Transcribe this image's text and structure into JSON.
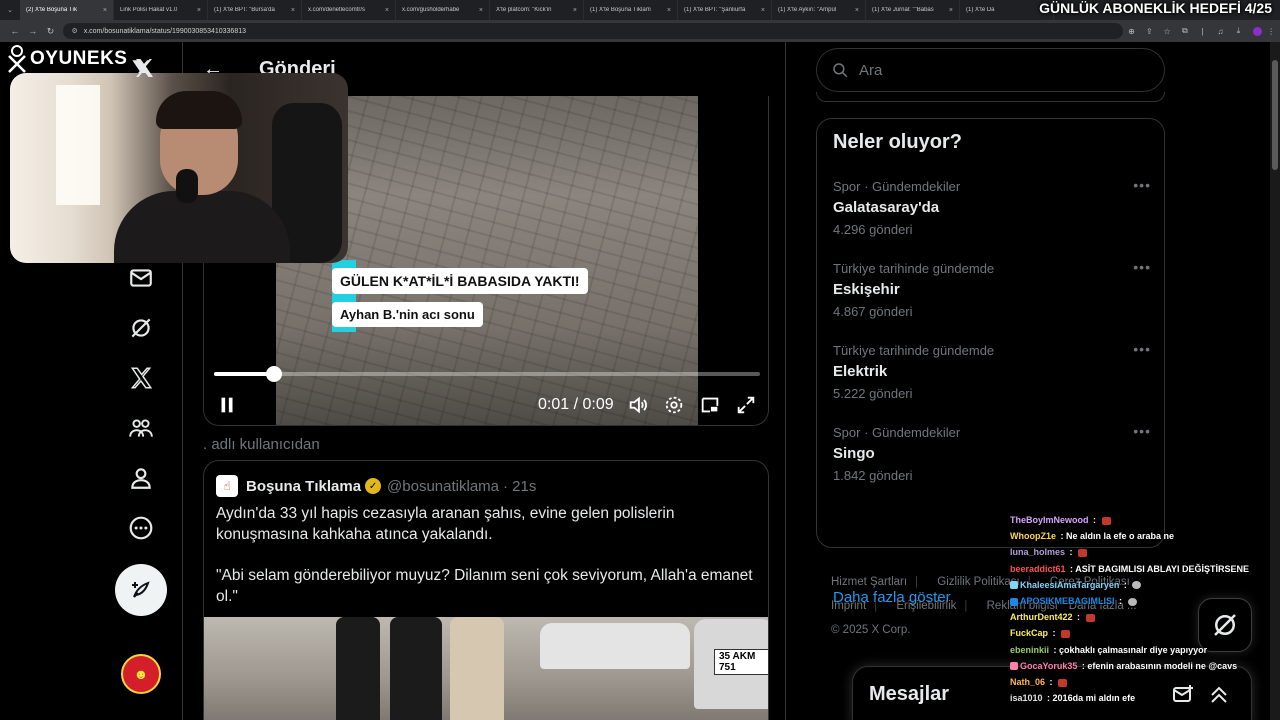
{
  "browser": {
    "tabs": [
      {
        "label": "(2) X'te Boşuna Tık",
        "active": true
      },
      {
        "label": "Link Polisi Hakat v1.0",
        "active": false
      },
      {
        "label": "(1) X'te BPT: \"Bursa'da",
        "active": false
      },
      {
        "label": "x.com/denetlecomtr/s",
        "active": false
      },
      {
        "label": "x.com/gusholderhabe",
        "active": false
      },
      {
        "label": "X'te platcom: \"Kick'in",
        "active": false
      },
      {
        "label": "(1) X'te Boşuna Tıklam",
        "active": false
      },
      {
        "label": "(1) X'te BPT: \"Şanlıurfa",
        "active": false
      },
      {
        "label": "(1) X'te Aykırı: \"Ampül",
        "active": false
      },
      {
        "label": "(1) X'te Jurnal: \"\"Babas",
        "active": false
      },
      {
        "label": "(1) X'te Da",
        "active": false
      }
    ],
    "url": "x.com/bosunatiklama/status/1990030853410336813"
  },
  "stream": {
    "goal_text": "GÜNLÜK ABONEKLİK HEDEFİ 4/25",
    "logo_text": "OYUNEKS",
    "chat": [
      {
        "user": "TheBoyImNewood",
        "message": "",
        "color": "#d9a2ff",
        "emote": "red"
      },
      {
        "user": "WhoopZ1e",
        "message": "Ne aldın la efe o araba ne",
        "color": "#ffd54f",
        "emote": ""
      },
      {
        "user": "luna_holmes",
        "message": "",
        "color": "#b39ddb",
        "emote": "red"
      },
      {
        "user": "beeraddict61",
        "message": "ASİT BAGIMLISI ABLAYI DEĞİŞTİRSENE",
        "color": "#ff5252",
        "emote": ""
      },
      {
        "user": "KhaleesiAmaTargaryen",
        "message": "",
        "color": "#81d4fa",
        "emote": "grey"
      },
      {
        "user": "APOSIKMEBAGIMLISI",
        "message": "",
        "color": "#1e88e5",
        "emote": "grey"
      },
      {
        "user": "ArthurDent422",
        "message": "",
        "color": "#ffee58",
        "emote": "red"
      },
      {
        "user": "FuckCap",
        "message": "",
        "color": "#ffee58",
        "emote": "red"
      },
      {
        "user": "ebeninkii",
        "message": "çokhaklı çalmasınalr diye yapıyyor",
        "color": "#9ccc65",
        "emote": ""
      },
      {
        "user": "GocaYoruk35",
        "message": "efenin arabasının modeli ne @cavs",
        "color": "#ff80ab",
        "emote": ""
      },
      {
        "user": "Nath_06",
        "message": "",
        "color": "#ffb74d",
        "emote": "red"
      },
      {
        "user": "isa1010",
        "message": "2016da mi aldın efe",
        "color": "#e0e0e0",
        "emote": ""
      }
    ]
  },
  "header": {
    "title": "Gönderi"
  },
  "video": {
    "caption_line1": "GÜLEN K*AT*İL*İ BABASIDA YAKTI!",
    "caption_line2": "Ayhan B.'nin acı sonu",
    "time": "0:01 / 0:09",
    "progress": 0.11
  },
  "quoted_from": ". adlı kullanıcıdan",
  "quote": {
    "name": "Boşuna Tıklama",
    "handle": "@bosunatiklama",
    "time": "· 21s",
    "text_p1": "Aydın'da 33 yıl hapis cezasıyla aranan şahıs, evine gelen polislerin konuşmasına kahkaha atınca yakalandı.",
    "text_p2": "\"Abi selam gönderebiliyor muyuz? Dilanım seni çok seviyorum, Allah'a emanet ol.\"",
    "plate": "35 AKM 751"
  },
  "search": {
    "placeholder": "Ara"
  },
  "trends": {
    "title": "Neler oluyor?",
    "items": [
      {
        "context": "Spor · Gündemdekiler",
        "name": "Galatasaray'da",
        "count": "4.296 gönderi"
      },
      {
        "context": "Türkiye tarihinde gündemde",
        "name": "Eskişehir",
        "count": "4.867 gönderi"
      },
      {
        "context": "Türkiye tarihinde gündemde",
        "name": "Elektrik",
        "count": "5.222 gönderi"
      },
      {
        "context": "Spor · Gündemdekiler",
        "name": "Singo",
        "count": "1.842 gönderi"
      }
    ],
    "show_more": "Daha fazla göster"
  },
  "footer": {
    "links": [
      "Hizmet Şartları",
      "Gizlilik Politikası",
      "Çerez Politikası",
      "Imprint",
      "Erişilebilirlik",
      "Reklam bilgisi",
      "Daha fazla ..."
    ],
    "copyright": "© 2025 X Corp."
  },
  "messages": {
    "title": "Mesajlar"
  },
  "colors": {
    "accent": "#1d9bf0",
    "background": "#000000",
    "border": "#2f3336",
    "muted": "#71767b"
  },
  "icons": [
    "x-logo-icon",
    "mail-icon",
    "grok-icon",
    "x-icon",
    "communities-icon",
    "profile-icon",
    "more-icon",
    "post-icon",
    "search-icon",
    "back-arrow-icon",
    "pause-icon",
    "volume-icon",
    "settings-icon",
    "pip-icon",
    "fullscreen-icon",
    "compose-message-icon",
    "chevron-up-icon"
  ]
}
